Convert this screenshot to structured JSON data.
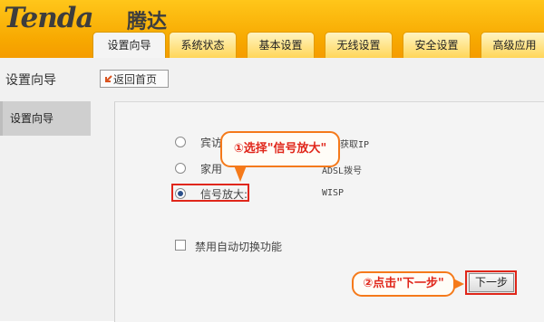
{
  "header": {
    "logo": "Tenda",
    "logo_cn": "腾达",
    "tabs": [
      {
        "label": "设置向导",
        "active": true
      },
      {
        "label": "系统状态"
      },
      {
        "label": "基本设置"
      },
      {
        "label": "无线设置"
      },
      {
        "label": "安全设置"
      },
      {
        "label": "高级应用"
      }
    ]
  },
  "subbar": {
    "title": "设置向导",
    "back_label": "返回首页"
  },
  "sidebar": {
    "items": [
      {
        "label": "设置向导"
      }
    ]
  },
  "options": [
    {
      "label": "宾访",
      "desc": "获取IP",
      "checked": false
    },
    {
      "label": "家用",
      "desc": "ADSL拨号",
      "checked": false
    },
    {
      "label": "信号放大:",
      "desc": "WISP",
      "checked": true
    }
  ],
  "checkbox": {
    "label": "禁用自动切换功能",
    "checked": false
  },
  "callouts": {
    "step1": "①选择\"信号放大\"",
    "step2": "②点击\"下一步\""
  },
  "next_button": "下一步",
  "colors": {
    "header": "#f7a800",
    "highlight": "#e0261a",
    "callout_border": "#f57a1a"
  }
}
